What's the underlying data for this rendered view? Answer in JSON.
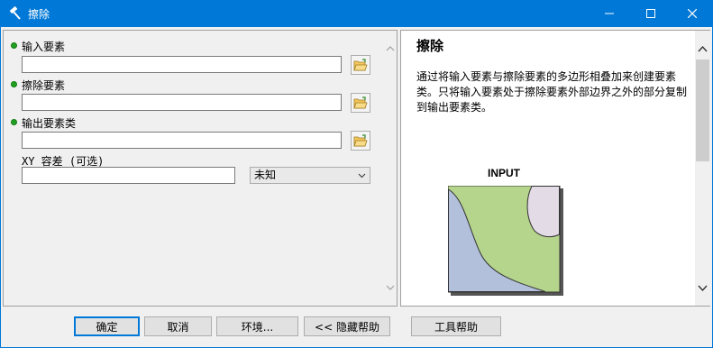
{
  "window": {
    "title": "擦除"
  },
  "params": {
    "input_features_label": "输入要素",
    "input_features_value": "",
    "erase_features_label": "擦除要素",
    "erase_features_value": "",
    "output_feature_class_label": "输出要素类",
    "output_feature_class_value": "",
    "xy_tolerance_label": "XY 容差 (可选)",
    "xy_tolerance_value": "",
    "xy_unit_selected": "未知"
  },
  "help": {
    "title": "擦除",
    "description": "通过将输入要素与擦除要素的多边形相叠加来创建要素类。只将输入要素处于擦除要素外部边界之外的部分复制到输出要素类。",
    "diagram_label": "INPUT"
  },
  "buttons": {
    "ok": "确定",
    "cancel": "取消",
    "environments": "环境...",
    "hide_help": "<< 隐藏帮助",
    "tool_help": "工具帮助"
  },
  "colors": {
    "titlebar": "#0078d7",
    "required_dot": "#21a121",
    "diagram_green": "#b5d48c",
    "diagram_blue": "#b3c0dc",
    "diagram_pink": "#e3dbe6"
  }
}
